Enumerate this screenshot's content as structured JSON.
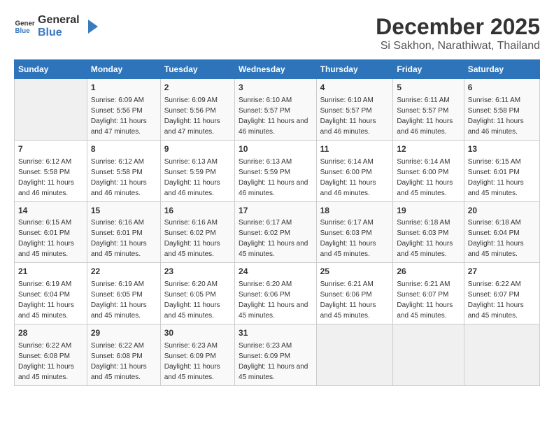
{
  "header": {
    "logo_general": "General",
    "logo_blue": "Blue",
    "month": "December 2025",
    "location": "Si Sakhon, Narathiwat, Thailand"
  },
  "weekdays": [
    "Sunday",
    "Monday",
    "Tuesday",
    "Wednesday",
    "Thursday",
    "Friday",
    "Saturday"
  ],
  "weeks": [
    [
      {
        "day": "",
        "sunrise": "",
        "sunset": "",
        "daylight": ""
      },
      {
        "day": "1",
        "sunrise": "Sunrise: 6:09 AM",
        "sunset": "Sunset: 5:56 PM",
        "daylight": "Daylight: 11 hours and 47 minutes."
      },
      {
        "day": "2",
        "sunrise": "Sunrise: 6:09 AM",
        "sunset": "Sunset: 5:56 PM",
        "daylight": "Daylight: 11 hours and 47 minutes."
      },
      {
        "day": "3",
        "sunrise": "Sunrise: 6:10 AM",
        "sunset": "Sunset: 5:57 PM",
        "daylight": "Daylight: 11 hours and 46 minutes."
      },
      {
        "day": "4",
        "sunrise": "Sunrise: 6:10 AM",
        "sunset": "Sunset: 5:57 PM",
        "daylight": "Daylight: 11 hours and 46 minutes."
      },
      {
        "day": "5",
        "sunrise": "Sunrise: 6:11 AM",
        "sunset": "Sunset: 5:57 PM",
        "daylight": "Daylight: 11 hours and 46 minutes."
      },
      {
        "day": "6",
        "sunrise": "Sunrise: 6:11 AM",
        "sunset": "Sunset: 5:58 PM",
        "daylight": "Daylight: 11 hours and 46 minutes."
      }
    ],
    [
      {
        "day": "7",
        "sunrise": "Sunrise: 6:12 AM",
        "sunset": "Sunset: 5:58 PM",
        "daylight": "Daylight: 11 hours and 46 minutes."
      },
      {
        "day": "8",
        "sunrise": "Sunrise: 6:12 AM",
        "sunset": "Sunset: 5:58 PM",
        "daylight": "Daylight: 11 hours and 46 minutes."
      },
      {
        "day": "9",
        "sunrise": "Sunrise: 6:13 AM",
        "sunset": "Sunset: 5:59 PM",
        "daylight": "Daylight: 11 hours and 46 minutes."
      },
      {
        "day": "10",
        "sunrise": "Sunrise: 6:13 AM",
        "sunset": "Sunset: 5:59 PM",
        "daylight": "Daylight: 11 hours and 46 minutes."
      },
      {
        "day": "11",
        "sunrise": "Sunrise: 6:14 AM",
        "sunset": "Sunset: 6:00 PM",
        "daylight": "Daylight: 11 hours and 46 minutes."
      },
      {
        "day": "12",
        "sunrise": "Sunrise: 6:14 AM",
        "sunset": "Sunset: 6:00 PM",
        "daylight": "Daylight: 11 hours and 45 minutes."
      },
      {
        "day": "13",
        "sunrise": "Sunrise: 6:15 AM",
        "sunset": "Sunset: 6:01 PM",
        "daylight": "Daylight: 11 hours and 45 minutes."
      }
    ],
    [
      {
        "day": "14",
        "sunrise": "Sunrise: 6:15 AM",
        "sunset": "Sunset: 6:01 PM",
        "daylight": "Daylight: 11 hours and 45 minutes."
      },
      {
        "day": "15",
        "sunrise": "Sunrise: 6:16 AM",
        "sunset": "Sunset: 6:01 PM",
        "daylight": "Daylight: 11 hours and 45 minutes."
      },
      {
        "day": "16",
        "sunrise": "Sunrise: 6:16 AM",
        "sunset": "Sunset: 6:02 PM",
        "daylight": "Daylight: 11 hours and 45 minutes."
      },
      {
        "day": "17",
        "sunrise": "Sunrise: 6:17 AM",
        "sunset": "Sunset: 6:02 PM",
        "daylight": "Daylight: 11 hours and 45 minutes."
      },
      {
        "day": "18",
        "sunrise": "Sunrise: 6:17 AM",
        "sunset": "Sunset: 6:03 PM",
        "daylight": "Daylight: 11 hours and 45 minutes."
      },
      {
        "day": "19",
        "sunrise": "Sunrise: 6:18 AM",
        "sunset": "Sunset: 6:03 PM",
        "daylight": "Daylight: 11 hours and 45 minutes."
      },
      {
        "day": "20",
        "sunrise": "Sunrise: 6:18 AM",
        "sunset": "Sunset: 6:04 PM",
        "daylight": "Daylight: 11 hours and 45 minutes."
      }
    ],
    [
      {
        "day": "21",
        "sunrise": "Sunrise: 6:19 AM",
        "sunset": "Sunset: 6:04 PM",
        "daylight": "Daylight: 11 hours and 45 minutes."
      },
      {
        "day": "22",
        "sunrise": "Sunrise: 6:19 AM",
        "sunset": "Sunset: 6:05 PM",
        "daylight": "Daylight: 11 hours and 45 minutes."
      },
      {
        "day": "23",
        "sunrise": "Sunrise: 6:20 AM",
        "sunset": "Sunset: 6:05 PM",
        "daylight": "Daylight: 11 hours and 45 minutes."
      },
      {
        "day": "24",
        "sunrise": "Sunrise: 6:20 AM",
        "sunset": "Sunset: 6:06 PM",
        "daylight": "Daylight: 11 hours and 45 minutes."
      },
      {
        "day": "25",
        "sunrise": "Sunrise: 6:21 AM",
        "sunset": "Sunset: 6:06 PM",
        "daylight": "Daylight: 11 hours and 45 minutes."
      },
      {
        "day": "26",
        "sunrise": "Sunrise: 6:21 AM",
        "sunset": "Sunset: 6:07 PM",
        "daylight": "Daylight: 11 hours and 45 minutes."
      },
      {
        "day": "27",
        "sunrise": "Sunrise: 6:22 AM",
        "sunset": "Sunset: 6:07 PM",
        "daylight": "Daylight: 11 hours and 45 minutes."
      }
    ],
    [
      {
        "day": "28",
        "sunrise": "Sunrise: 6:22 AM",
        "sunset": "Sunset: 6:08 PM",
        "daylight": "Daylight: 11 hours and 45 minutes."
      },
      {
        "day": "29",
        "sunrise": "Sunrise: 6:22 AM",
        "sunset": "Sunset: 6:08 PM",
        "daylight": "Daylight: 11 hours and 45 minutes."
      },
      {
        "day": "30",
        "sunrise": "Sunrise: 6:23 AM",
        "sunset": "Sunset: 6:09 PM",
        "daylight": "Daylight: 11 hours and 45 minutes."
      },
      {
        "day": "31",
        "sunrise": "Sunrise: 6:23 AM",
        "sunset": "Sunset: 6:09 PM",
        "daylight": "Daylight: 11 hours and 45 minutes."
      },
      {
        "day": "",
        "sunrise": "",
        "sunset": "",
        "daylight": ""
      },
      {
        "day": "",
        "sunrise": "",
        "sunset": "",
        "daylight": ""
      },
      {
        "day": "",
        "sunrise": "",
        "sunset": "",
        "daylight": ""
      }
    ]
  ]
}
